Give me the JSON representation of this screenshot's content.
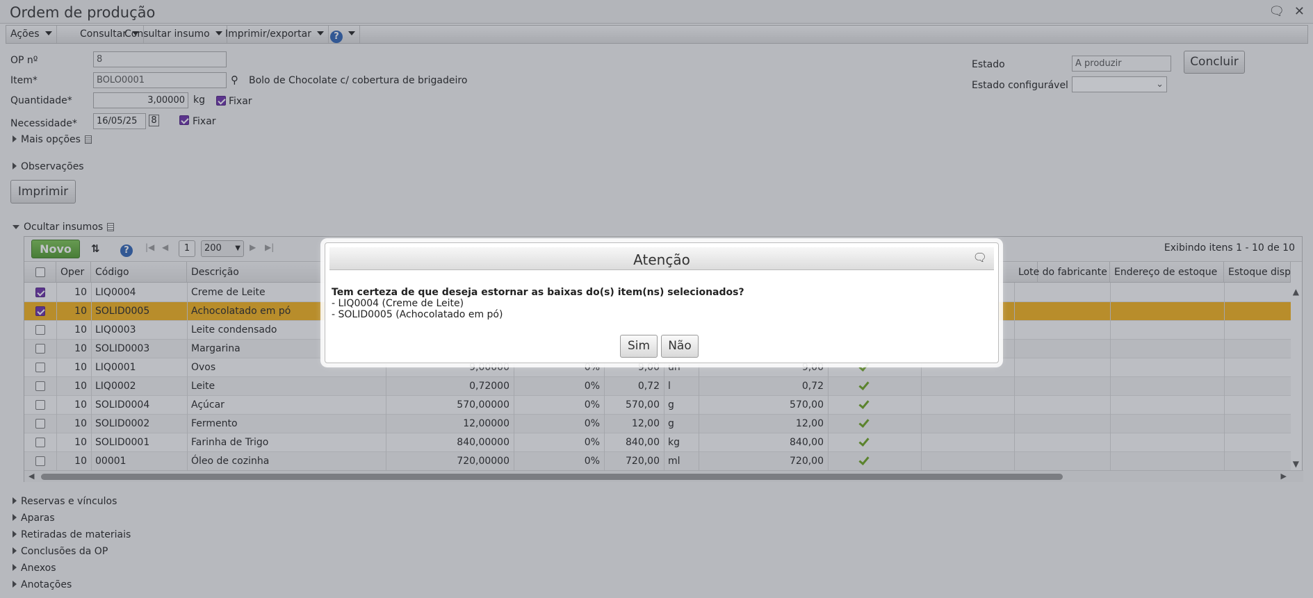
{
  "window": {
    "title": "Ordem de produção"
  },
  "menu": {
    "acoes": "Ações",
    "consultar": "Consultar",
    "consultar_insumo": "Consultar insumo",
    "imprimir": "Imprimir/exportar",
    "help": "?"
  },
  "form": {
    "op_label": "OP nº",
    "op_value": "8",
    "item_label": "Item*",
    "item_value": "BOLO0001",
    "item_desc": "Bolo de Chocolate c/ cobertura de brigadeiro",
    "qtd_label": "Quantidade*",
    "qtd_value": "3,00000",
    "qtd_unit": "kg",
    "fixar": "Fixar",
    "nec_label": "Necessidade*",
    "nec_value": "16/05/25",
    "mais_opcoes": "Mais opções",
    "observacoes": "Observações",
    "imprimir": "Imprimir",
    "estado_label": "Estado",
    "estado_value": "A produzir",
    "estado_conf_label": "Estado configurável",
    "concluir": "Concluir"
  },
  "insumos": {
    "toggle": "Ocultar insumos",
    "novo": "Novo",
    "page": "1",
    "page_size": "200",
    "showing": "Exibindo itens 1 - 10 de 10",
    "headers": [
      "Oper",
      "Código",
      "Descrição",
      "Lote do fabricante",
      "Endereço de estoque",
      "Estoque disponível"
    ],
    "rows": [
      {
        "oper": "10",
        "codigo": "LIQ0004",
        "descricao": "Creme de Leite",
        "checked": true
      },
      {
        "oper": "10",
        "codigo": "SOLID0005",
        "descricao": "Achocolatado em pó",
        "checked": true
      },
      {
        "oper": "10",
        "codigo": "LIQ0003",
        "descricao": "Leite condensado",
        "checked": false
      },
      {
        "oper": "10",
        "codigo": "SOLID0003",
        "descricao": "Margarina",
        "checked": false
      },
      {
        "oper": "10",
        "codigo": "LIQ0001",
        "descricao": "Ovos",
        "qtd": "9,00000",
        "perc": "0%",
        "val": "9,00",
        "un": "un",
        "total": "9,00",
        "checked": false
      },
      {
        "oper": "10",
        "codigo": "LIQ0002",
        "descricao": "Leite",
        "qtd": "0,72000",
        "perc": "0%",
        "val": "0,72",
        "un": "l",
        "total": "0,72",
        "checked": false
      },
      {
        "oper": "10",
        "codigo": "SOLID0004",
        "descricao": "Açúcar",
        "qtd": "570,00000",
        "perc": "0%",
        "val": "570,00",
        "un": "g",
        "total": "570,00",
        "checked": false
      },
      {
        "oper": "10",
        "codigo": "SOLID0002",
        "descricao": "Fermento",
        "qtd": "12,00000",
        "perc": "0%",
        "val": "12,00",
        "un": "g",
        "total": "12,00",
        "checked": false
      },
      {
        "oper": "10",
        "codigo": "SOLID0001",
        "descricao": "Farinha de Trigo",
        "qtd": "840,00000",
        "perc": "0%",
        "val": "840,00",
        "un": "kg",
        "total": "840,00",
        "checked": false
      },
      {
        "oper": "10",
        "codigo": "00001",
        "descricao": "Óleo de cozinha",
        "qtd": "720,00000",
        "perc": "0%",
        "val": "720,00",
        "un": "ml",
        "total": "720,00",
        "checked": false
      }
    ]
  },
  "sections": [
    "Reservas e vínculos",
    "Aparas",
    "Retiradas de materiais",
    "Conclusões da OP",
    "Anexos",
    "Anotações"
  ],
  "modal": {
    "title": "Atenção",
    "question": "Tem certeza de que deseja estornar as baixas do(s) item(ns) selecionados?",
    "line1": "- LIQ0004 (Creme de Leite)",
    "line2": "- SOLID0005 (Achocolatado em pó)",
    "sim": "Sim",
    "nao": "Não"
  }
}
